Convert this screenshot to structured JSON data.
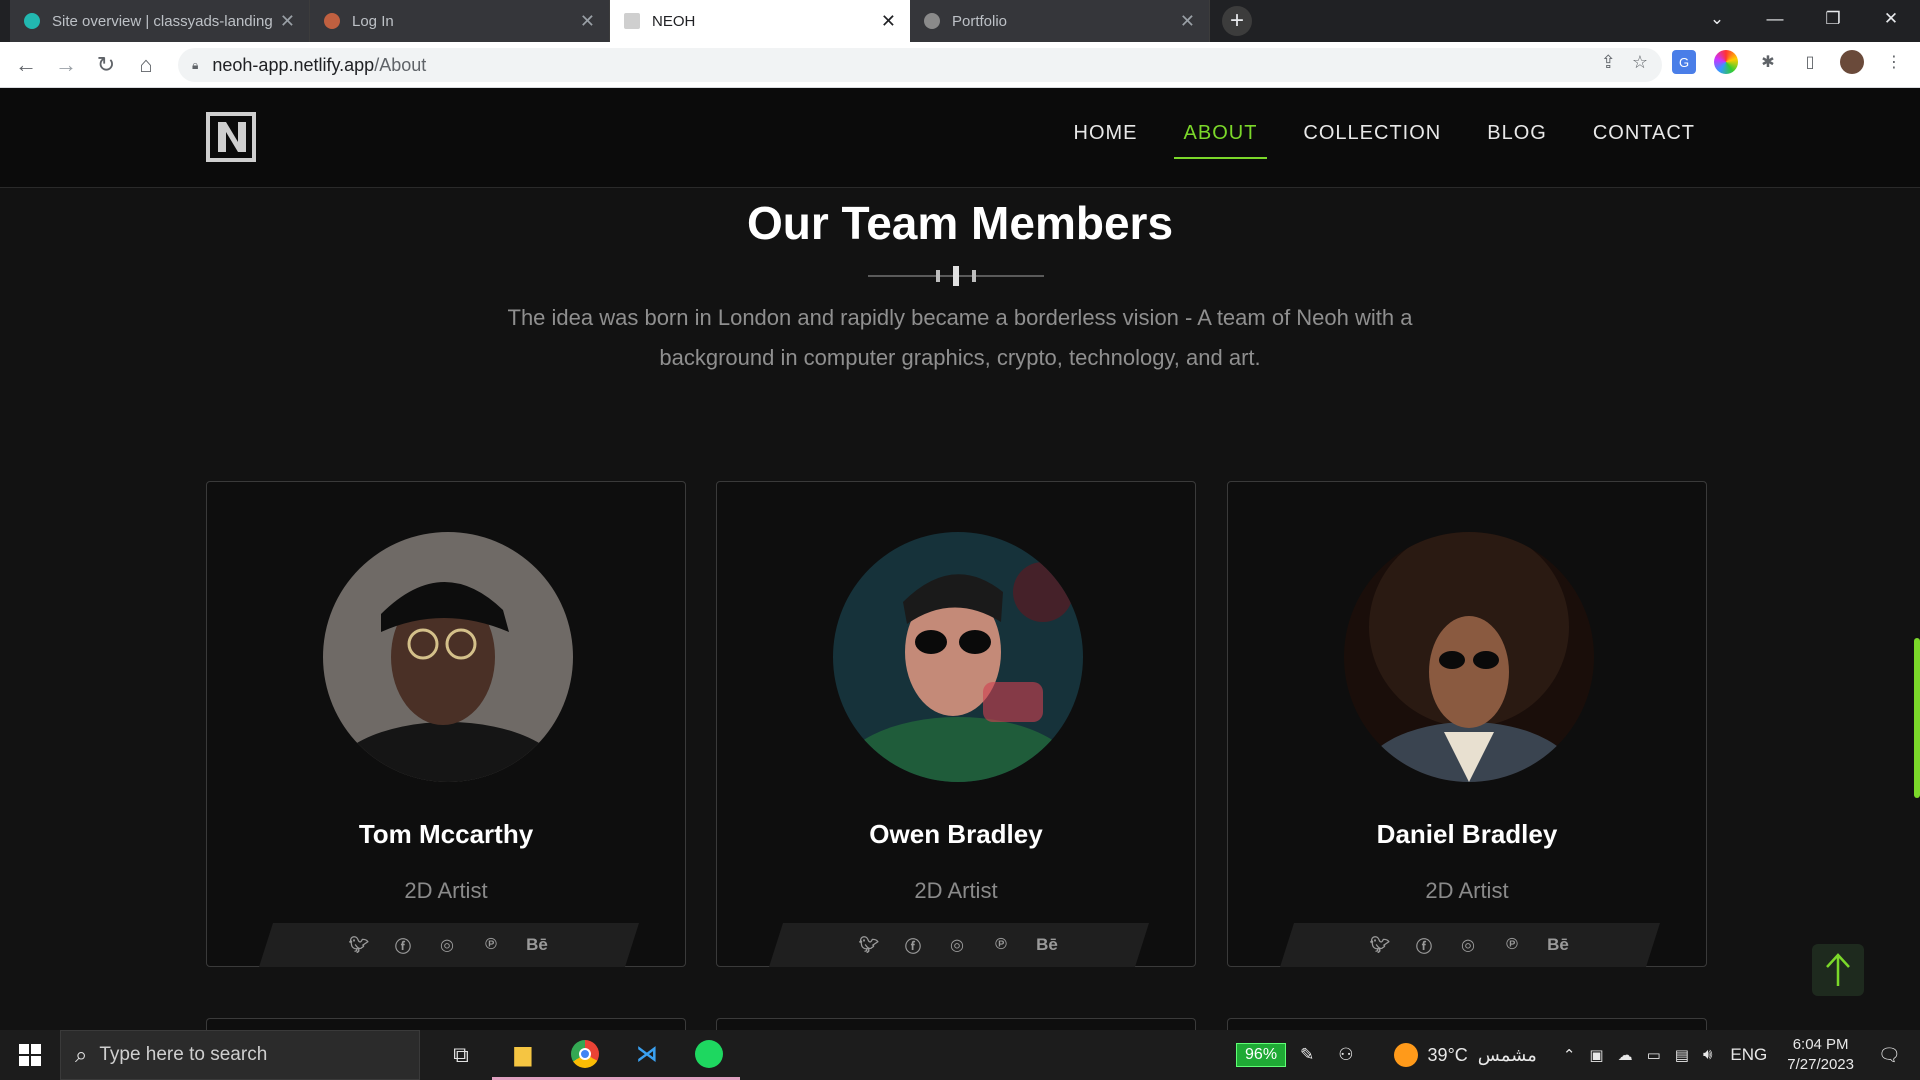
{
  "browser": {
    "tabs": [
      {
        "label": "Site overview | classyads-landing",
        "active": false,
        "favicon_color": "#22b8b0"
      },
      {
        "label": "Log In",
        "active": false,
        "favicon_color": "#c06040"
      },
      {
        "label": "NEOH",
        "active": true,
        "favicon_color": "#9a9a9a"
      },
      {
        "label": "Portfolio",
        "active": false,
        "favicon_color": "#8a8a8a"
      }
    ],
    "url_host": "neoh-app.netlify.app",
    "url_path": "/About"
  },
  "site": {
    "nav": [
      {
        "label": "HOME",
        "active": false
      },
      {
        "label": "ABOUT",
        "active": true
      },
      {
        "label": "COLLECTION",
        "active": false
      },
      {
        "label": "BLOG",
        "active": false
      },
      {
        "label": "CONTACT",
        "active": false
      }
    ],
    "accent_color": "#7bd82a",
    "section_title": "Our Team Members",
    "intro": "The idea was born in London and rapidly became a borderless vision - A team of Neoh with a background in computer graphics, crypto, technology, and art."
  },
  "team": [
    {
      "name": "Tom Mccarthy",
      "role": "2D Artist"
    },
    {
      "name": "Owen Bradley",
      "role": "2D Artist"
    },
    {
      "name": "Daniel Bradley",
      "role": "2D Artist"
    }
  ],
  "social_icons": [
    "twitter-icon",
    "facebook-icon",
    "instagram-icon",
    "pinterest-icon",
    "behance-icon"
  ],
  "behance_label": "Bē",
  "taskbar": {
    "search_placeholder": "Type here to search",
    "battery": "96%",
    "temperature": "39°C",
    "weather_text": "مشمس",
    "language": "ENG",
    "time": "6:04 PM",
    "date": "7/27/2023"
  }
}
